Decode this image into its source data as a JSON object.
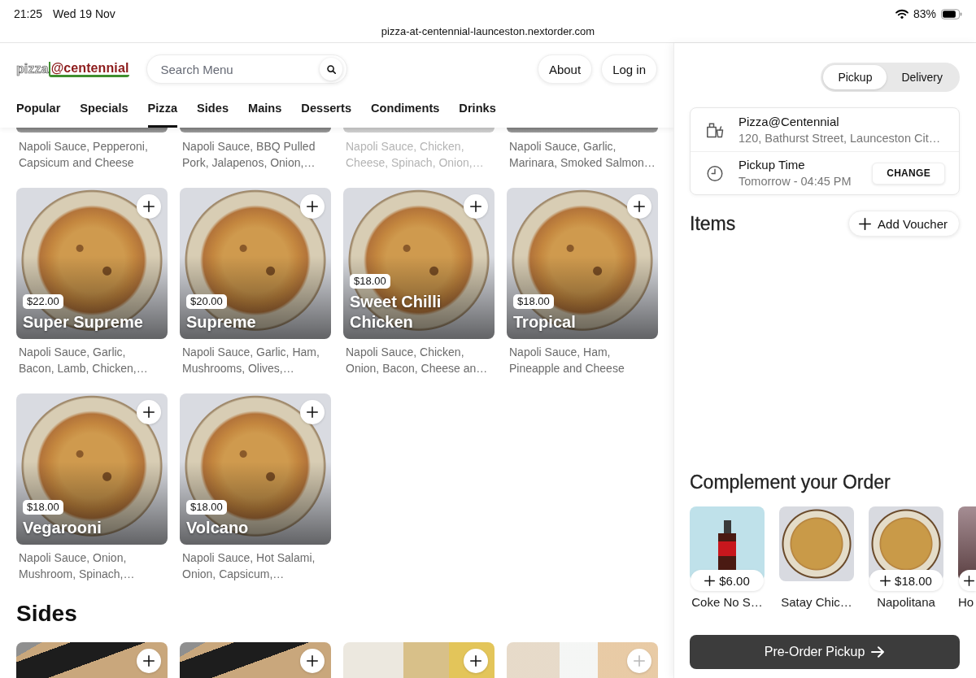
{
  "status_bar": {
    "time": "21:25",
    "date": "Wed 19 Nov",
    "battery": "83%"
  },
  "address_bar": {
    "url": "pizza-at-centennial-launceston.nextorder.com"
  },
  "header": {
    "logo": {
      "prefix": "pizza",
      "suffix": "@centennial"
    },
    "search": {
      "placeholder": "Search Menu"
    },
    "buttons": [
      "About",
      "Log in"
    ]
  },
  "categories": [
    {
      "label": "Popular",
      "selected": false
    },
    {
      "label": "Specials",
      "selected": false
    },
    {
      "label": "Pizza",
      "selected": true
    },
    {
      "label": "Sides",
      "selected": false
    },
    {
      "label": "Mains",
      "selected": false
    },
    {
      "label": "Desserts",
      "selected": false
    },
    {
      "label": "Condiments",
      "selected": false
    },
    {
      "label": "Drinks",
      "selected": false
    }
  ],
  "pizza_items": [
    {
      "kind": "cut",
      "description": [
        "Napoli Sauce, Pepperoni,",
        "Capsicum and Cheese"
      ],
      "unavailable": false
    },
    {
      "kind": "cut",
      "description": [
        "Napoli Sauce, BBQ Pulled",
        "Pork, Jalapenos, Onion,…"
      ],
      "unavailable": false
    },
    {
      "kind": "cut",
      "description": [
        "Napoli Sauce, Chicken,",
        "Cheese, Spinach, Onion,…"
      ],
      "unavailable": true
    },
    {
      "kind": "cut",
      "description": [
        "Napoli Sauce, Garlic,",
        "Marinara, Smoked Salmon…"
      ],
      "unavailable": false
    },
    {
      "kind": "full",
      "name": "Super Supreme",
      "price": "$22.00",
      "description": [
        "Napoli Sauce, Garlic,",
        "Bacon, Lamb, Chicken,…"
      ],
      "unavailable": false
    },
    {
      "kind": "full",
      "name": "Supreme",
      "price": "$20.00",
      "description": [
        "Napoli Sauce, Garlic, Ham,",
        "Mushrooms, Olives,…"
      ],
      "unavailable": false
    },
    {
      "kind": "full",
      "name": "Sweet Chilli Chicken",
      "price": "$18.00",
      "description": [
        "Napoli Sauce, Chicken,",
        "Onion, Bacon, Cheese an…"
      ],
      "unavailable": false
    },
    {
      "kind": "full",
      "name": "Tropical",
      "price": "$18.00",
      "description": [
        "Napoli Sauce, Ham,",
        "Pineapple and Cheese"
      ],
      "unavailable": false
    },
    {
      "kind": "full",
      "name": "Vegarooni",
      "price": "$18.00",
      "description": [
        "Napoli Sauce, Onion,",
        "Mushroom, Spinach,…"
      ],
      "unavailable": false
    },
    {
      "kind": "full",
      "name": "Volcano",
      "price": "$18.00",
      "description": [
        "Napoli Sauce, Hot Salami,",
        "Onion, Capsicum,…"
      ],
      "unavailable": false
    }
  ],
  "sides": {
    "title": "Sides",
    "items": [
      {
        "kind": "box",
        "unavailable": false
      },
      {
        "kind": "box",
        "unavailable": false
      },
      {
        "kind": "basket",
        "unavailable": false
      },
      {
        "kind": "tray",
        "unavailable": true
      }
    ]
  },
  "order_panel": {
    "modes": [
      {
        "label": "Pickup",
        "selected": true
      },
      {
        "label": "Delivery",
        "selected": false
      }
    ],
    "store": {
      "name": "Pizza@Centennial",
      "address": "120, Bathurst Street, Launceston Cit…"
    },
    "pickup_time": {
      "label": "Pickup Time",
      "value": "Tomorrow - 04:45 PM",
      "button": "CHANGE"
    },
    "items_title": "Items",
    "voucher_button": "Add Voucher",
    "complement": {
      "title": "Complement your Order",
      "items": [
        {
          "kind": "drink",
          "name": "Coke No S…",
          "price": "$6.00",
          "add_button": true
        },
        {
          "kind": "pizza",
          "name": "Satay Chic…",
          "add_button": false
        },
        {
          "kind": "pizza",
          "name": "Napolitana",
          "price": "$18.00",
          "add_button": true
        },
        {
          "kind": "other",
          "name": "Ho",
          "add_button": true
        }
      ]
    },
    "checkout_button": "Pre-Order Pickup"
  }
}
